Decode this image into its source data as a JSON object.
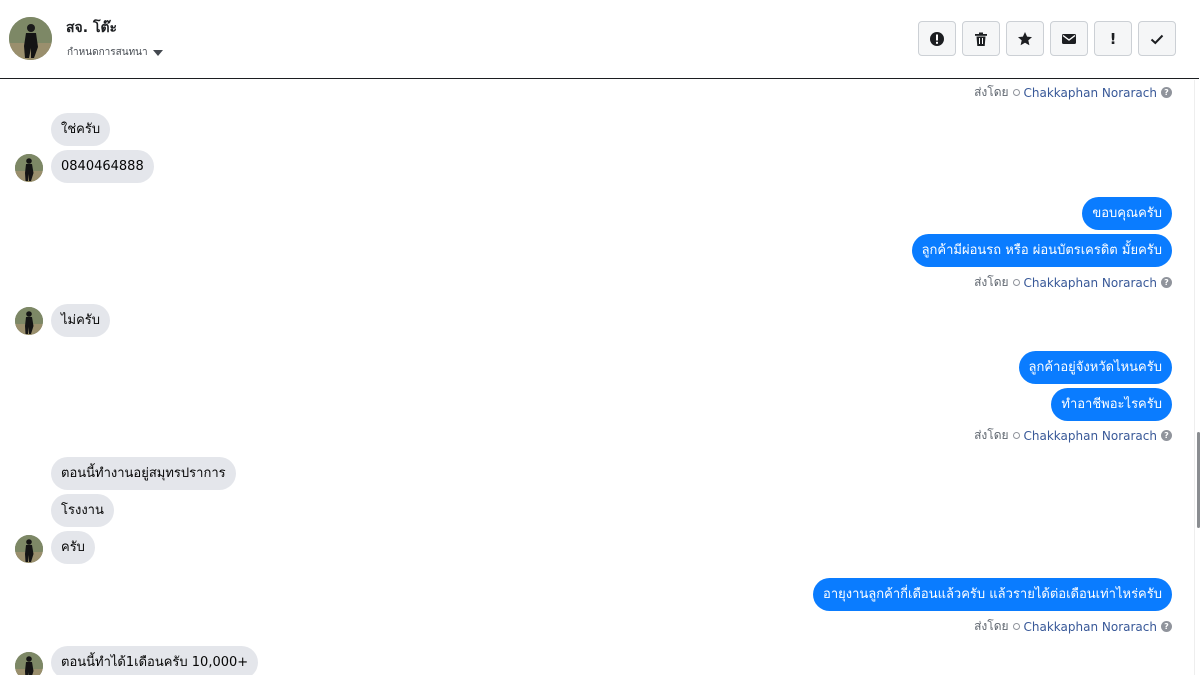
{
  "header": {
    "contact_name": "สจ. โต๊ะ",
    "conversation_menu": "กำหนดการสนทนา",
    "actions": [
      {
        "name": "mark-spam",
        "icon": "alert-circle-icon"
      },
      {
        "name": "delete",
        "icon": "trash-icon"
      },
      {
        "name": "star",
        "icon": "star-icon"
      },
      {
        "name": "mark-unread",
        "icon": "envelope-icon"
      },
      {
        "name": "follow-up",
        "icon": "exclamation-icon",
        "glyph": "!"
      },
      {
        "name": "mark-done",
        "icon": "checkmark-icon"
      }
    ]
  },
  "sent_by": {
    "prefix": "ส่งโดย",
    "name": "Chakkaphan Norarach",
    "help": "?"
  },
  "messages": [
    {
      "dir": "in",
      "text": "ใช่ครับ"
    },
    {
      "dir": "in",
      "text": "0840464888"
    },
    {
      "dir": "out",
      "text": "ขอบคุณครับ"
    },
    {
      "dir": "out",
      "text": "ลูกค้ามีผ่อนรถ หรือ ผ่อนบัตรเครดิต มั้ยครับ"
    },
    {
      "dir": "in",
      "text": "ไม่ครับ"
    },
    {
      "dir": "out",
      "text": "ลูกค้าอยู่จังหวัดไหนครับ"
    },
    {
      "dir": "out",
      "text": "ทำอาชีพอะไรครับ"
    },
    {
      "dir": "in",
      "text": "ตอนนี้ทำงานอยู่สมุทรปราการ"
    },
    {
      "dir": "in",
      "text": "โรงงาน"
    },
    {
      "dir": "in",
      "text": "ครับ"
    },
    {
      "dir": "out",
      "text": "อายุงานลูกค้ากี่เดือนแล้วครับ แล้วรายได้ต่อเดือนเท่าไหร่ครับ"
    },
    {
      "dir": "in",
      "text": "ตอนนี้ทำได้1เดือนครับ 10,000+"
    }
  ]
}
